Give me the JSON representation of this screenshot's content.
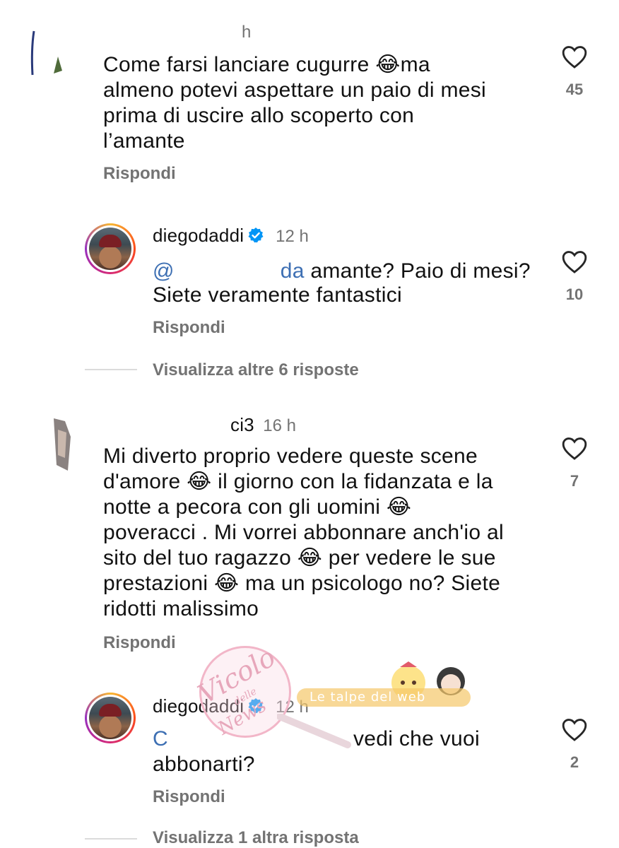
{
  "comments": [
    {
      "time": "h",
      "text_lines": [
        "Come farsi lanciare cugurre 😂ma",
        "almeno potevi aspettare un paio di mesi",
        "prima di uscire allo scoperto con",
        "l’amante"
      ],
      "reply_label": "Rispondi",
      "likes": "45"
    },
    {
      "username": "diegodaddi",
      "time": "12 h",
      "mention_fragment": "@",
      "mention_tail": "da",
      "line1_rest": " amante? Paio di mesi?",
      "line2": "Sietе veramente fantastici",
      "reply_label": "Rispondi",
      "likes": "10",
      "view_more": "Visualizza altre 6 risposte"
    },
    {
      "username_tail": "ci3",
      "time": "16 h",
      "text_lines": [
        "Mi diverto proprio vedere queste scene",
        "d'amore 😂 il giorno con la fidanzata e la",
        "notte a pecora con gli uomini 😂",
        "poveracci . Mi vorrei abbonnare anch'io al",
        "sito del tuo ragazzo 😂 per vedere le sue",
        "prestazioni 😂 ma un psicologo no? Siete",
        "ridotti malissimo"
      ],
      "reply_label": "Rispondi",
      "likes": "7"
    },
    {
      "username": "diegodaddi",
      "time": "12 h",
      "mention_fragment": "C",
      "line1_rest": "vedi che vuoi",
      "line2": "abbonarti?",
      "reply_label": "Rispondi",
      "likes": "2",
      "view_more": "Visualizza 1 altra risposta"
    }
  ],
  "watermark": {
    "name": "Vicolo",
    "sub": "delle",
    "tail": "News",
    "banner": "Le talpe del web"
  },
  "icons": {
    "like": "heart-outline-icon",
    "verified": "verified-badge-icon"
  },
  "colors": {
    "text": "#111111",
    "muted": "#737373",
    "verified": "#0095f6",
    "link": "#3d6fb3"
  }
}
